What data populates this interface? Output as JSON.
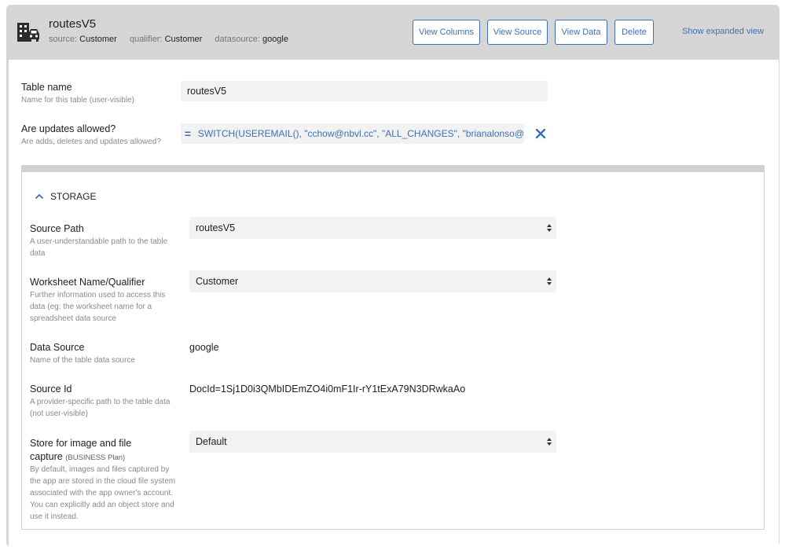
{
  "header": {
    "title": "routesV5",
    "source_label": "source:",
    "source_value": "Customer",
    "qualifier_label": "qualifier:",
    "qualifier_value": "Customer",
    "datasource_label": "datasource:",
    "datasource_value": "google",
    "buttons": {
      "view_columns": "View Columns",
      "view_source": "View Source",
      "view_data": "View Data",
      "delete": "Delete"
    },
    "expanded_link": "Show expanded view"
  },
  "fields": {
    "table_name": {
      "label": "Table name",
      "help": "Name for this table (user-visible)",
      "value": "routesV5"
    },
    "updates_allowed": {
      "label": "Are updates allowed?",
      "help": "Are adds, deletes and updates allowed?",
      "eq_symbol": "=",
      "formula": "SWITCH(USEREMAIL(),   \"cchow@nbvl.cc\", \"ALL_CHANGES\",   \"brianalonso@"
    }
  },
  "storage": {
    "section_title": "STORAGE",
    "source_path": {
      "label": "Source Path",
      "help": "A user-understandable path to the table data",
      "value": "routesV5"
    },
    "worksheet": {
      "label": "Worksheet Name/Qualifier",
      "help": "Further information used to access this data (eg: the worksheet name for a spreadsheet data source",
      "value": "Customer"
    },
    "data_source": {
      "label": "Data Source",
      "help": "Name of the table data source",
      "value": "google"
    },
    "source_id": {
      "label": "Source Id",
      "help": "A provider-specific path to the table data (not user-visible)",
      "value": "DocId=1Sj1D0i3QMbIDEmZO4i0mF1Ir-rY1tExA79N3DRwkaAo"
    },
    "store": {
      "label_line1": "Store for image and file",
      "label_line2": "capture",
      "plan": "(BUSINESS Plan)",
      "help": "By default, images and files captured by the app are stored in the cloud file system associated with the app owner's account. You can explicitly add an object store and use it instead.",
      "value": "Default"
    }
  },
  "colors": {
    "accent": "#3f6fb5",
    "header_bg": "#d6d6d6",
    "field_bg": "#f2f2f2"
  },
  "icons": [
    "table-car-icon",
    "clear-formula-icon",
    "chevron-up-icon",
    "select-arrows-icon"
  ]
}
